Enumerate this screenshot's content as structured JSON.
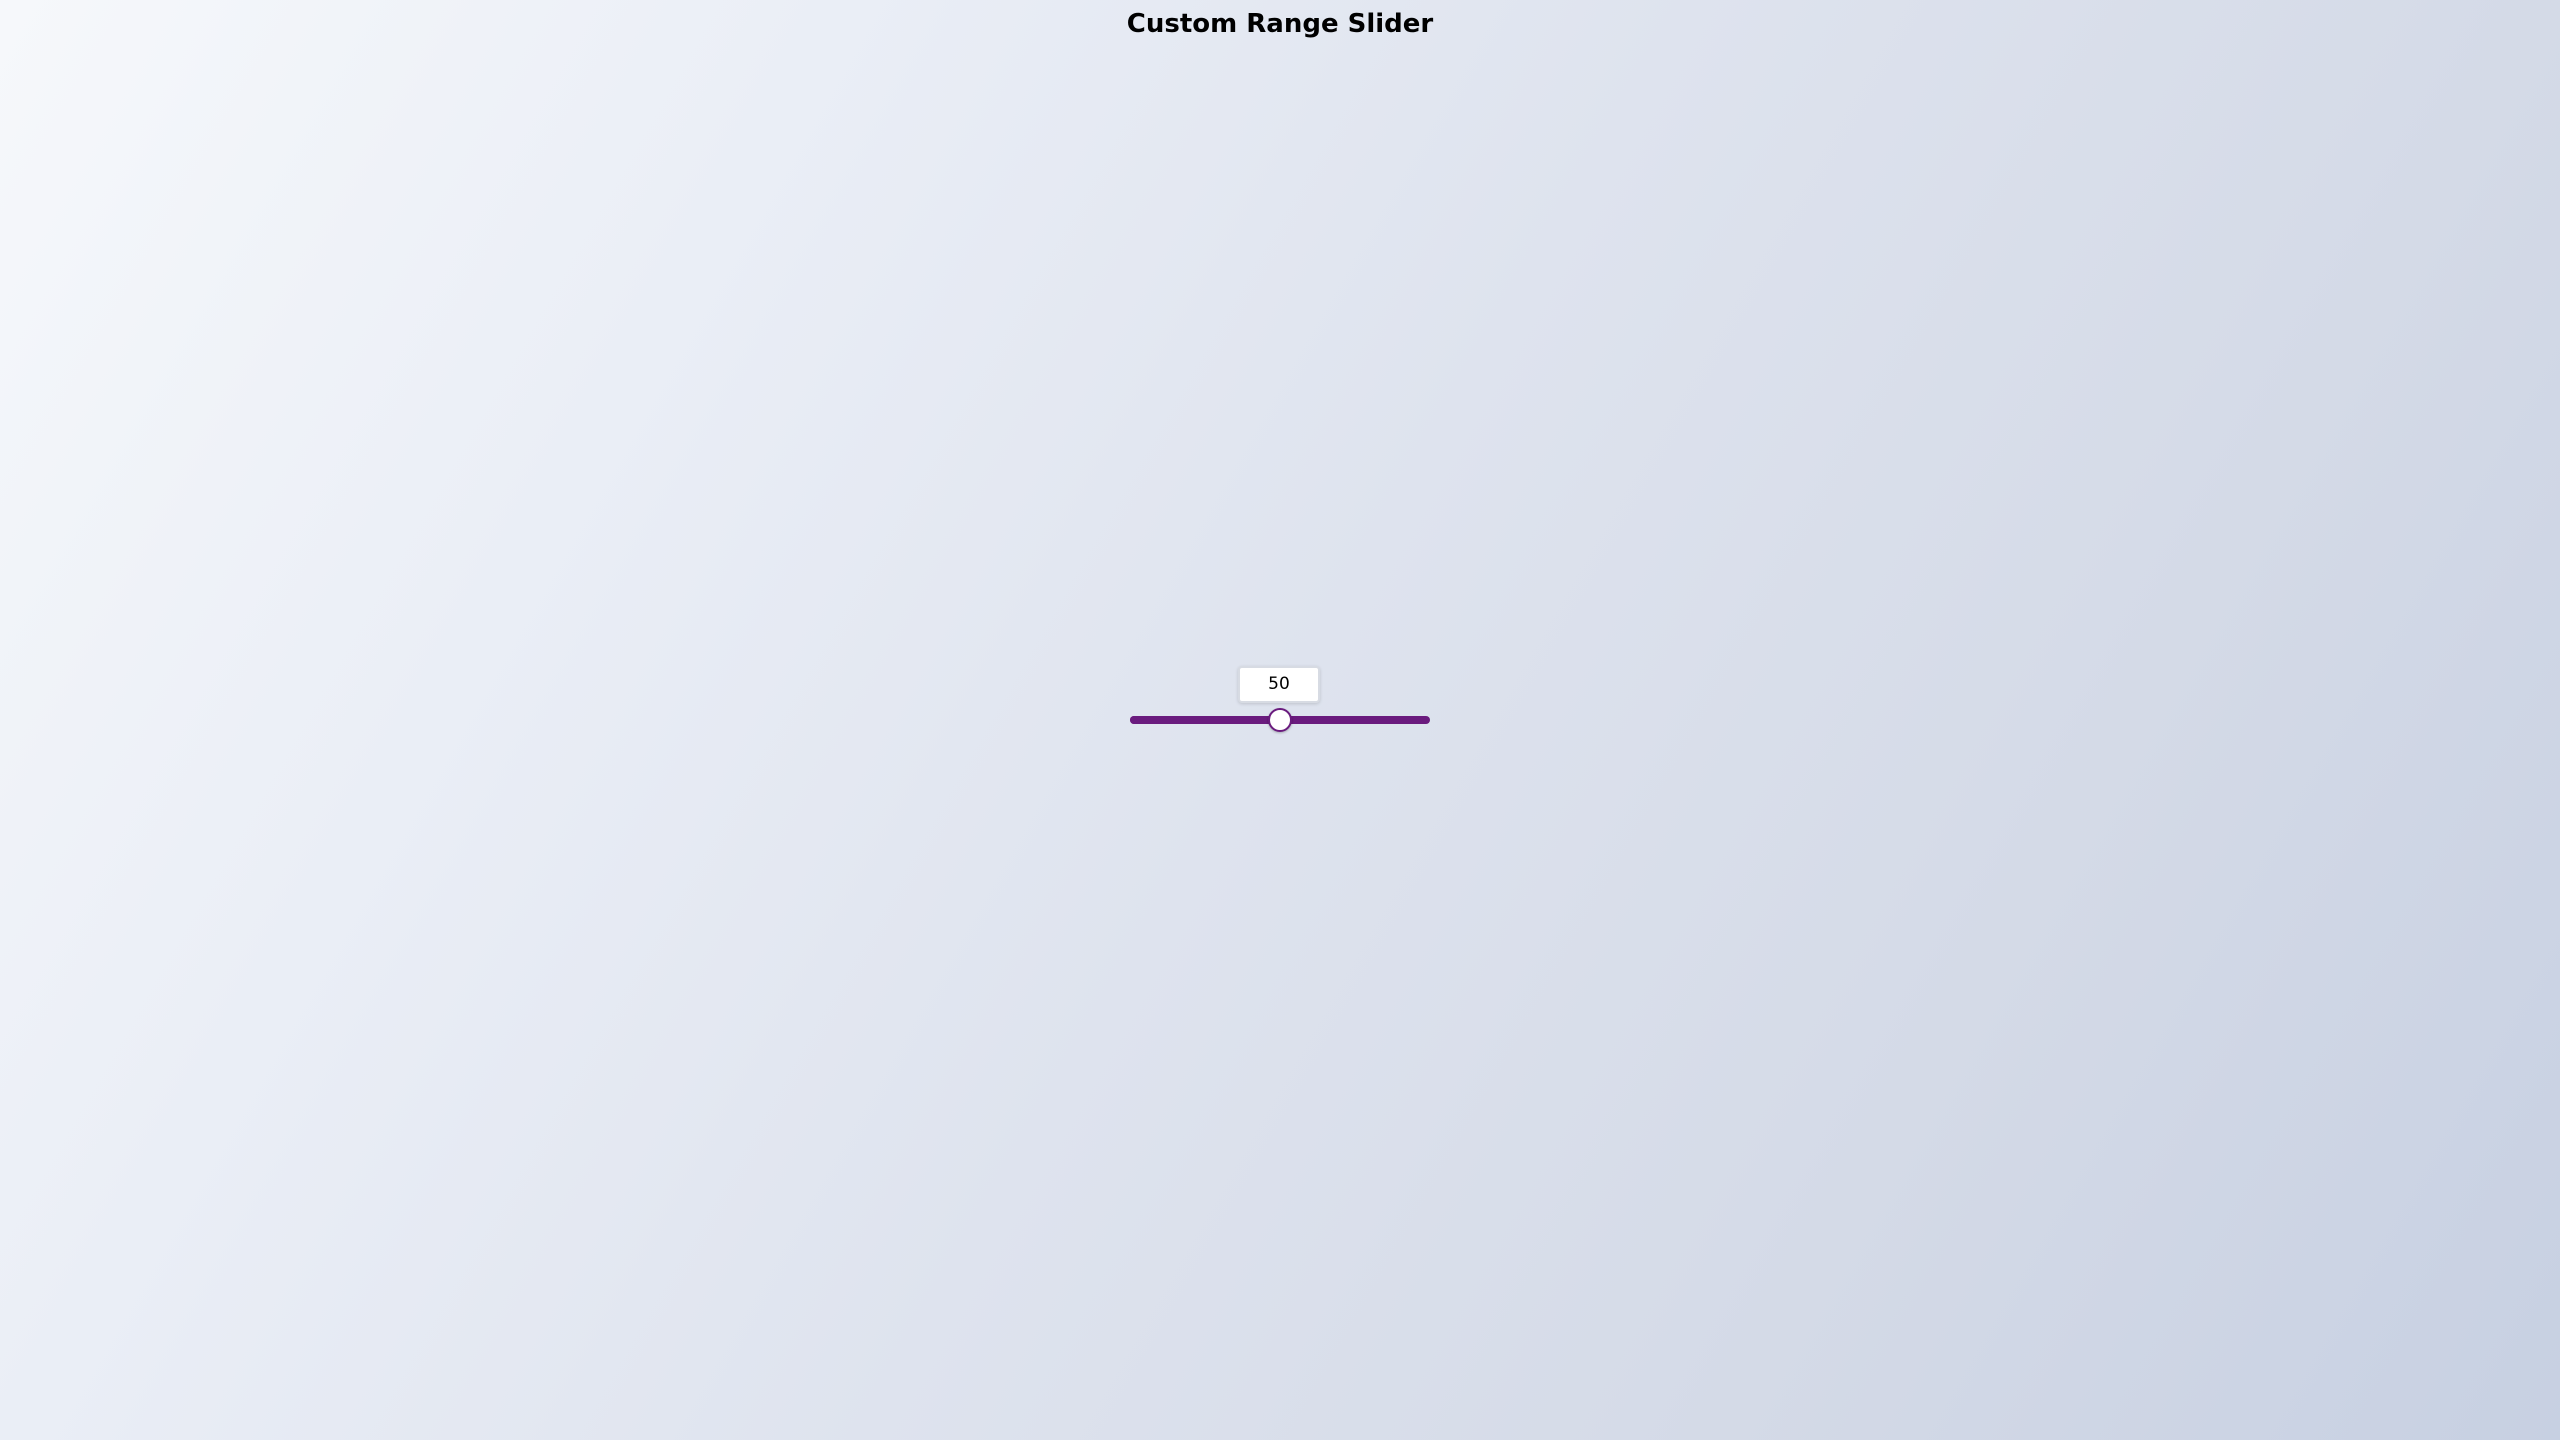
{
  "page": {
    "title": "Custom Range Slider"
  },
  "slider": {
    "value": "50",
    "min": 0,
    "max": 100,
    "level": 50,
    "track_color": "#6a1b7e",
    "thumb_color": "#ffffff"
  }
}
